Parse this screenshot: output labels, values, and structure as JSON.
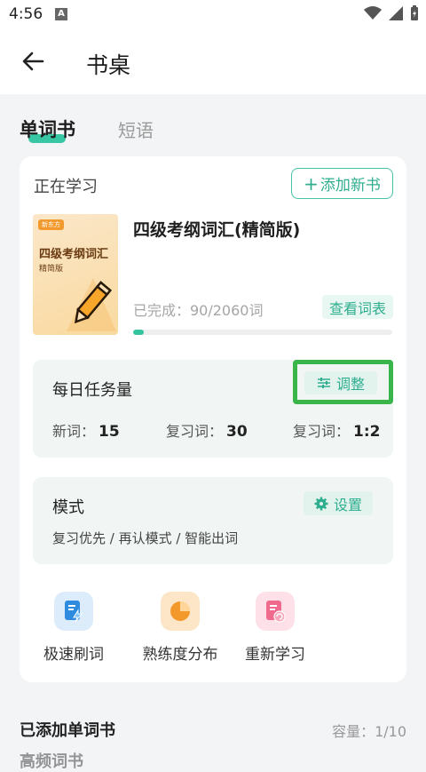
{
  "status_bar": {
    "time": "4:56",
    "notification_letter": "A"
  },
  "header": {
    "title": "书桌"
  },
  "tabs": [
    {
      "label": "单词书",
      "active": true
    },
    {
      "label": "短语",
      "active": false
    }
  ],
  "learning": {
    "label": "正在学习",
    "add_button": "添加新书",
    "book": {
      "cover_tag": "新东方",
      "cover_title": "四级考纲词汇",
      "cover_subtitle": "精简版",
      "title": "四级考纲词汇(精简版)",
      "progress_text": "已完成：90/2060词",
      "progress_fraction": 0.04,
      "view_words": "查看词表"
    }
  },
  "daily_task": {
    "title": "每日任务量",
    "adjust_label": "调整",
    "new_words_label": "新词：",
    "new_words": "15",
    "review_label": "复习词：",
    "review": "30",
    "ratio_label": "复习词：",
    "ratio": "1:2"
  },
  "mode": {
    "title": "模式",
    "settings_label": "设置",
    "description": "复习优先 / 再认模式 / 智能出词"
  },
  "actions": [
    {
      "label": "极速刷词",
      "icon": "fast-review-icon",
      "color": "#2f8be0"
    },
    {
      "label": "熟练度分布",
      "icon": "pie-chart-icon",
      "color": "#f3992b"
    },
    {
      "label": "重新学习",
      "icon": "restart-icon",
      "color": "#ef6a8c"
    }
  ],
  "added_books": {
    "title": "已添加单词书",
    "capacity": "容量：1/10",
    "next_item_partial": "高频词书"
  },
  "colors": {
    "accent": "#2fae8f",
    "highlight_box": "#3ab54a"
  }
}
